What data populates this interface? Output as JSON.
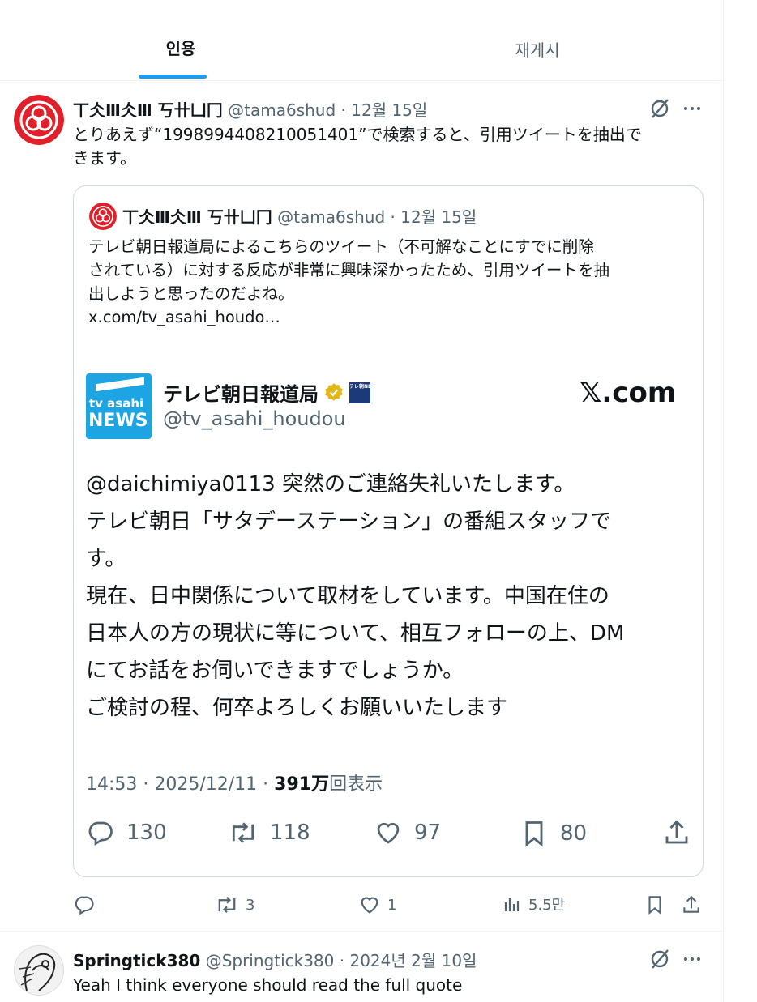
{
  "tabs": [
    {
      "label": "인용",
      "active": true
    },
    {
      "label": "재게시",
      "active": false
    }
  ],
  "post1": {
    "display_name": "丅仌Ⅲ仌Ⅲ 丂卄凵冂",
    "handle": "@tama6shud",
    "sep": "·",
    "date": "12월 15일",
    "text_line1": "とりあえず“1998994408210051401”で検索すると、引用ツイートを抽出で",
    "text_line2": "きます。",
    "quote": {
      "display_name": "丅仌Ⅲ仌Ⅲ 丂卄凵冂",
      "handle": "@tama6shud",
      "sep": "·",
      "date": "12월 15일",
      "line1": "テレビ朝日報道局によるこちらのツイート（不可解なことにすでに削除",
      "line2": "されている）に対する反応が非常に興味深かったため、引用ツイートを抽",
      "line3": "出しようと思ったのだよね。",
      "link": "x.com/tv_asahi_houdo…",
      "embedded": {
        "logo_line1": "tv asahi",
        "logo_line2": "NEWS",
        "account_name": "テレビ朝日報道局",
        "handle": "@tv_asahi_houdou",
        "badge_text": "テレ朝NEWS",
        "site": "𝕏.com",
        "body_line1": "@daichimiya0113 突然のご連絡失礼いたします。",
        "body_line2": "テレビ朝日「サタデーステーション」の番組スタッフで",
        "body_line3": "す。",
        "body_line4": "現在、日中関係について取材をしています。中国在住の",
        "body_line5": "日本人の方の現状に等について、相互フォローの上、DM",
        "body_line6": "にてお話をお伺いできますでしょうか。",
        "body_line7": "ご検討の程、何卒よろしくお願いいたします",
        "time": "14:53 · 2025/12/11 · ",
        "views": "391万",
        "views_suffix": "回表示",
        "replies": "130",
        "reposts": "118",
        "likes": "97",
        "bookmarks": "80"
      }
    },
    "actions": {
      "replies": "",
      "reposts": "3",
      "likes": "1",
      "views": "5.5만"
    }
  },
  "post2": {
    "display_name": "Springtick380",
    "handle": "@Springtick380",
    "sep": "·",
    "date": "2024년 2월 10일",
    "text": "Yeah I think everyone should read the full quote"
  },
  "colors": {
    "accent": "#1d9bf0",
    "secondary_text": "#536471",
    "border": "#eff3f4",
    "avatar_red": "#e0202a",
    "tv_asahi_blue": "#1ca4e3"
  },
  "icons": [
    "grok-icon",
    "more-icon",
    "reply-icon",
    "repost-icon",
    "like-icon",
    "views-icon",
    "bookmark-icon",
    "share-icon",
    "verified-icon"
  ]
}
